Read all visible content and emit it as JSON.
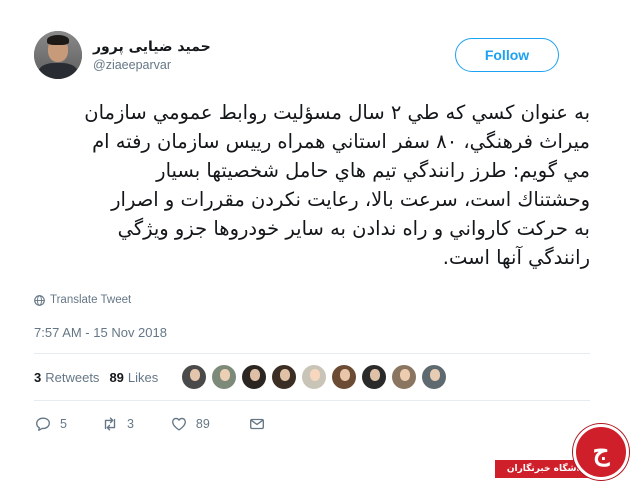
{
  "user": {
    "display_name": "حمید ضیایی پرور",
    "handle": "@ziaeeparvar"
  },
  "follow_label": "Follow",
  "tweet": {
    "lines": [
      "به عنوان كسي كه طي ٢ سال مسؤليت روابط عمومي سازمان",
      "ميراث فرهنگي، ٨٠ سفر استاني همراه رييس سازمان رفته ام",
      "مي گويم: طرز رانندگي تيم هاي حامل شخصيتها بسيار",
      "وحشتناك است، سرعت بالا، رعايت نكردن مقررات و اصرار",
      "به حركت كارواني و راه ندادن به ساير خودروها جزو ويژگي",
      "رانندگي آنها است."
    ]
  },
  "translate_label": "Translate Tweet",
  "timestamp": "7:57 AM - 15 Nov 2018",
  "stats": {
    "retweets_count": "3",
    "retweets_label": "Retweets",
    "likes_count": "89",
    "likes_label": "Likes"
  },
  "liker_avatar_colors": [
    "#4a4a4a",
    "#7d8a7a",
    "#2b2622",
    "#3b2e24",
    "#c9c4b8",
    "#6b4b34",
    "#2a2a2a",
    "#8a7560",
    "#5e6a70"
  ],
  "actions": {
    "reply_count": "5",
    "retweet_count": "3",
    "like_count": "89"
  },
  "watermark": {
    "logo_text": "ج",
    "bar_text": "باشگاه خبرنگاران"
  },
  "colors": {
    "accent": "#1da1f2",
    "text": "#14171a",
    "muted": "#657786",
    "watermark_red": "#cf1f2a"
  }
}
